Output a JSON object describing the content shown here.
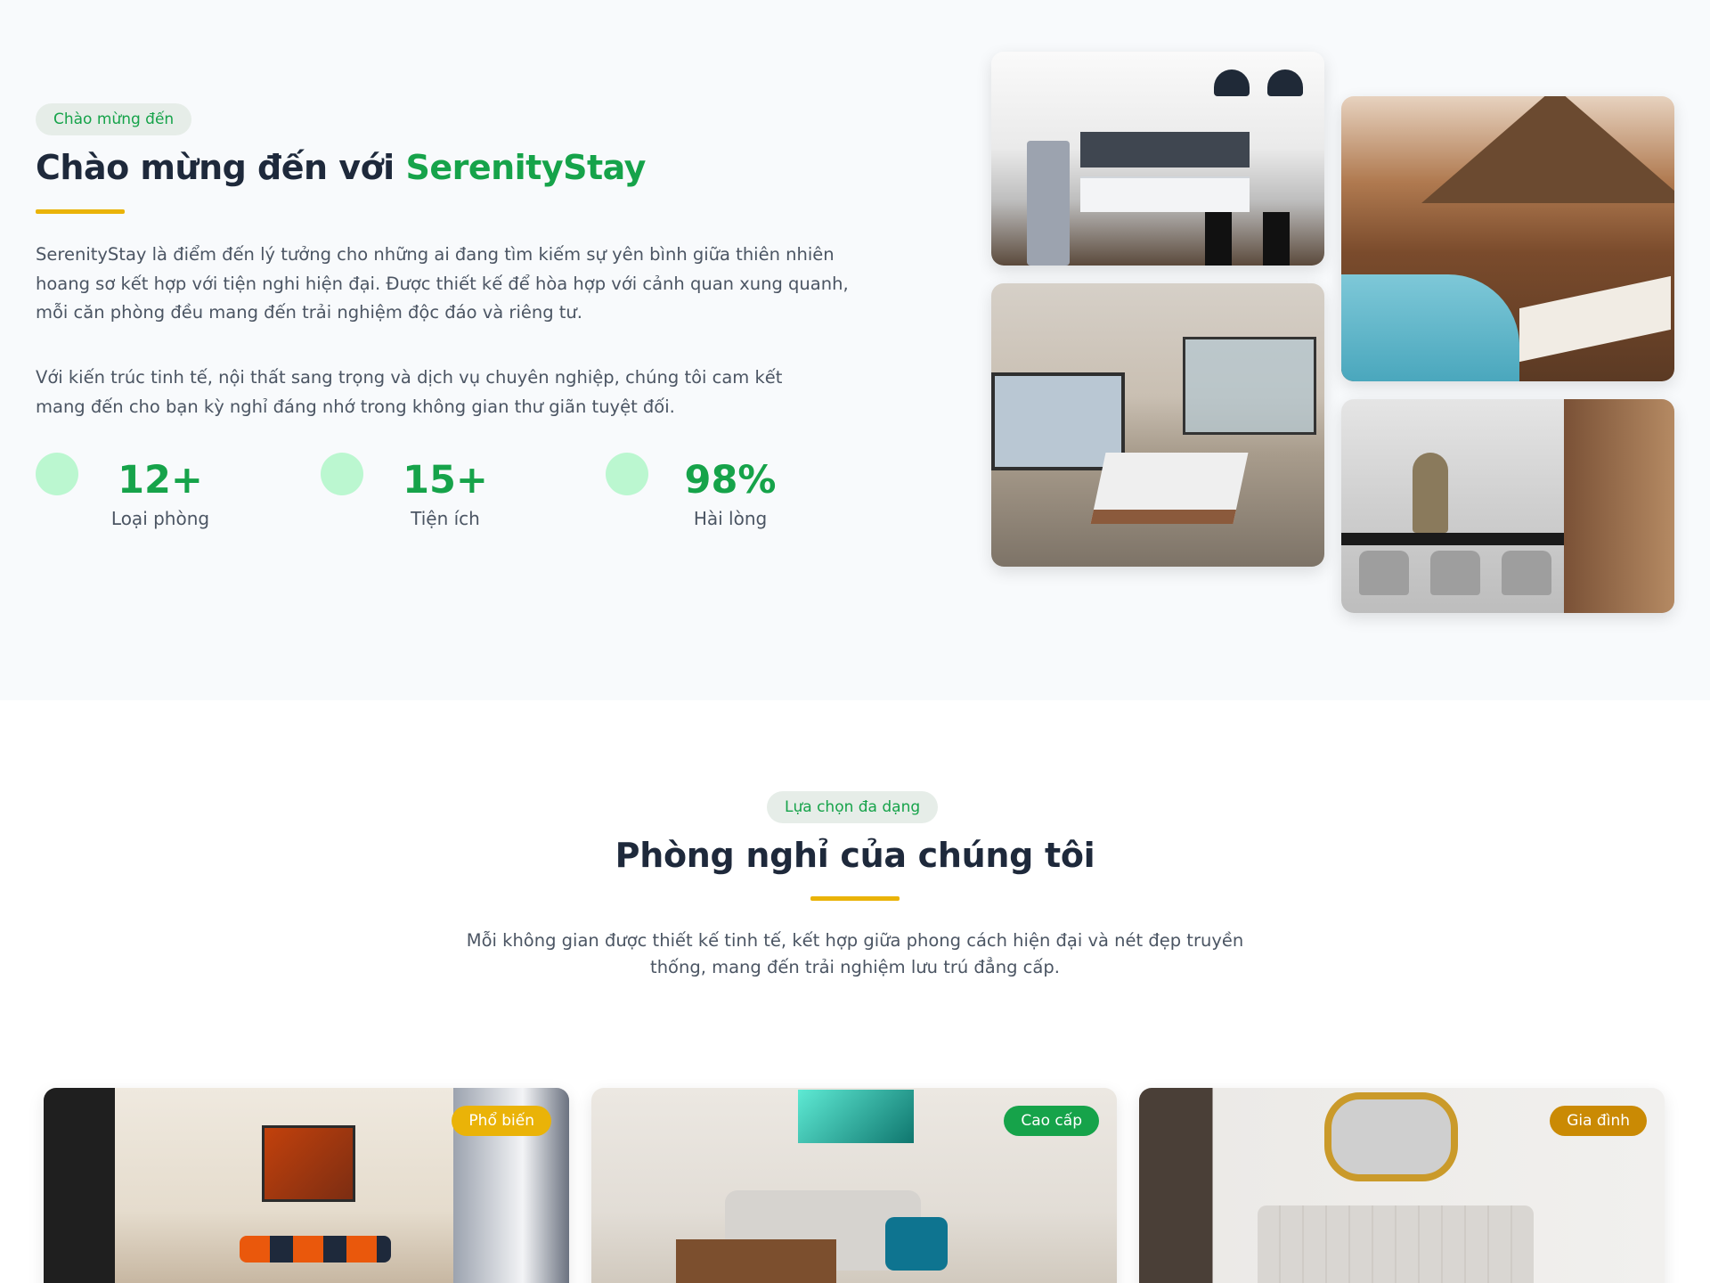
{
  "welcome": {
    "tag": "Chào mừng đến",
    "title_prefix": "Chào mừng đến với ",
    "title_brand": "SerenityStay",
    "paragraph_1": "SerenityStay là điểm đến lý tưởng cho những ai đang tìm kiếm sự yên bình giữa thiên nhiên hoang sơ kết hợp với tiện nghi hiện đại. Được thiết kế để hòa hợp với cảnh quan xung quanh, mỗi căn phòng đều mang đến trải nghiệm độc đáo và riêng tư.",
    "paragraph_2": "Với kiến trúc tinh tế, nội thất sang trọng và dịch vụ chuyên nghiệp, chúng tôi cam kết mang đến cho bạn kỳ nghỉ đáng nhớ trong không gian thư giãn tuyệt đối.",
    "stats": [
      {
        "value": "12+",
        "label": "Loại phòng"
      },
      {
        "value": "15+",
        "label": "Tiện ích"
      },
      {
        "value": "98%",
        "label": "Hài lòng"
      }
    ]
  },
  "rooms": {
    "tag": "Lựa chọn đa dạng",
    "title": "Phòng nghỉ của chúng tôi",
    "description": "Mỗi không gian được thiết kế tinh tế, kết hợp giữa phong cách hiện đại và nét đẹp truyền thống, mang đến trải nghiệm lưu trú đẳng cấp.",
    "cards": [
      {
        "badge": "Phổ biến",
        "badge_color": "#eab308"
      },
      {
        "badge": "Cao cấp",
        "badge_color": "#16a34a"
      },
      {
        "badge": "Gia đình",
        "badge_color": "#ca8a04"
      }
    ]
  },
  "colors": {
    "brand_green": "#16a34a",
    "accent_yellow": "#eab308",
    "heading": "#1e293b",
    "stat_dot": "#bbf7d0"
  }
}
